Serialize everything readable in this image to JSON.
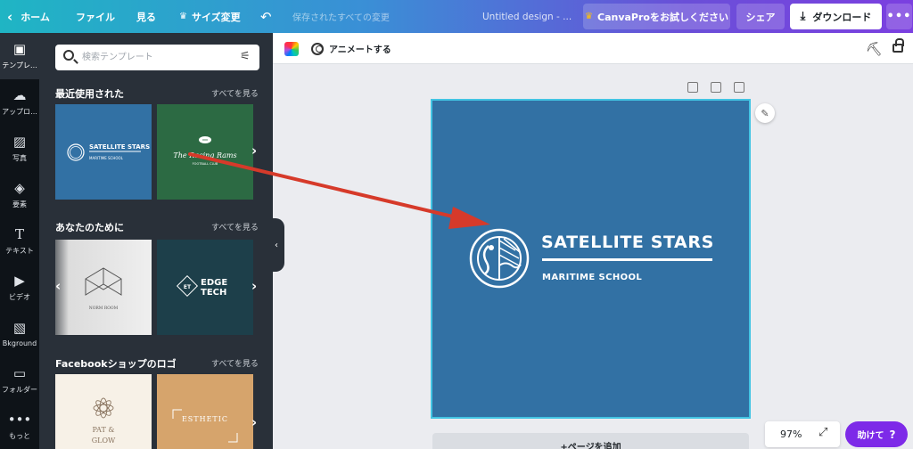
{
  "topbar": {
    "home": "ホーム",
    "file": "ファイル",
    "view": "見る",
    "resize": "サイズ変更",
    "saved_status": "保存されたすべての変更",
    "design_title": "Untitled design - ...",
    "try_pro": "CanvaProをお試しください",
    "share": "シェア",
    "download": "ダウンロード",
    "more": "•••"
  },
  "rail": [
    {
      "label": "テンプレ...",
      "icon": "layout-icon"
    },
    {
      "label": "アップロ...",
      "icon": "upload-icon"
    },
    {
      "label": "写真",
      "icon": "photo-icon"
    },
    {
      "label": "要素",
      "icon": "elements-icon"
    },
    {
      "label": "テキスト",
      "icon": "text-icon"
    },
    {
      "label": "ビデオ",
      "icon": "video-icon"
    },
    {
      "label": "Bkground",
      "icon": "background-icon"
    },
    {
      "label": "フォルダー",
      "icon": "folder-icon"
    },
    {
      "label": "もっと",
      "icon": "more-icon"
    }
  ],
  "panel": {
    "search_placeholder": "検索テンプレート",
    "sections": [
      {
        "title": "最近使用された",
        "see_all": "すべてを見る"
      },
      {
        "title": "あなたのために",
        "see_all": "すべてを見る"
      },
      {
        "title": "Facebookショップのロゴ",
        "see_all": "すべてを見る"
      }
    ],
    "thumbs": {
      "satellite_title": "SATELLITE STARS",
      "satellite_sub": "MARITIME SCHOOL",
      "rams_title": "The Racing Rams",
      "rams_sub": "FOOTBALL CLUB",
      "norm_room": "NORM ROOM",
      "edge_mark": "ET",
      "edge_line1": "EDGE",
      "edge_line2": "TECH",
      "glow_line1": "PAT &",
      "glow_line2": "GLOW",
      "esthetic": "ESTHETIC"
    }
  },
  "canvas_toolbar": {
    "animate": "アニメートする"
  },
  "design": {
    "title": "SATELLITE STARS",
    "subtitle": "MARITIME SCHOOL",
    "background": "#3271a4"
  },
  "add_page": "+ページを追加",
  "zoom": "97%",
  "help": "助けて",
  "help_mark": "?",
  "colors": {
    "accent_purple": "#7d2ae8",
    "annotation_red": "#d63a2a",
    "rail_bg": "#0e1318",
    "panel_bg": "#293039"
  }
}
